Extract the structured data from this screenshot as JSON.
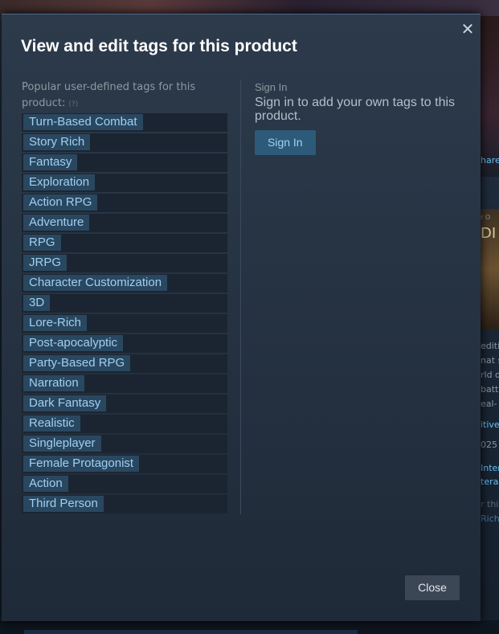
{
  "background": {
    "fragments": [
      {
        "text": "hare",
        "link": true
      },
      {
        "text": "r O"
      },
      {
        "text": "DI"
      },
      {
        "text": "editi"
      },
      {
        "text": "nat s"
      },
      {
        "text": "rld o"
      },
      {
        "text": "batt"
      },
      {
        "text": "eal-"
      },
      {
        "text": "itive",
        "link": true
      },
      {
        "text": "025"
      },
      {
        "text": "Inter",
        "link": true
      },
      {
        "text": "tera",
        "link": true
      },
      {
        "text": "r thi"
      },
      {
        "text": "Rich",
        "link": true
      }
    ]
  },
  "modal": {
    "title": "View and edit tags for this product",
    "close_icon": "close-icon",
    "popular_heading": "Popular user-defined tags for this product:",
    "help_marker": "(?)",
    "tags": [
      "Turn-Based Combat",
      "Story Rich",
      "Fantasy",
      "Exploration",
      "Action RPG",
      "Adventure",
      "RPG",
      "JRPG",
      "Character Customization",
      "3D",
      "Lore-Rich",
      "Post-apocalyptic",
      "Party-Based RPG",
      "Narration",
      "Dark Fantasy",
      "Realistic",
      "Singleplayer",
      "Female Protagonist",
      "Action",
      "Third Person"
    ],
    "signin_heading": "Sign In",
    "signin_text": "Sign in to add your own tags to this product.",
    "signin_button": "Sign In",
    "close_button": "Close"
  },
  "colors": {
    "tag_bg": "#2a4760",
    "tag_text": "#9ed0f2",
    "modal_bg": "#2c3a4b",
    "button_blue": "#2d5a78"
  }
}
